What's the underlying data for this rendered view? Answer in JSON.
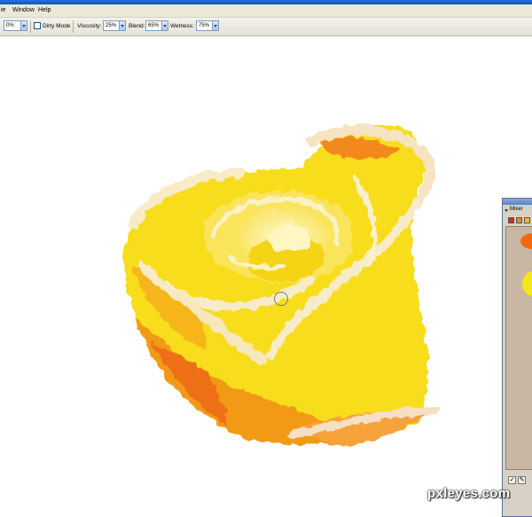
{
  "menu": {
    "items": [
      "ie",
      "Window",
      "Help"
    ]
  },
  "options": {
    "first_value": "0%",
    "dirty_mode_label": "Dirty Mode",
    "dirty_mode_checked": false,
    "viscosity_label": "Viscosity:",
    "viscosity_value": "25%",
    "blend_label": "Blend:",
    "blend_value": "65%",
    "wetness_label": "Wetness:",
    "wetness_value": "75%"
  },
  "mixer": {
    "title": "Mixer",
    "swatches": [
      "#d9262a",
      "#e58b1d",
      "#e8c21f",
      "#f2e31a"
    ],
    "paints": [
      "#f26a10",
      "#f5e61a"
    ]
  },
  "colors": {
    "rose_yellow": "#f5dd1c",
    "rose_orange": "#f07d14",
    "rose_cream": "#f8ecc8",
    "toolbar_bg": "#ece9d8"
  },
  "watermark": "pxleyes.com"
}
